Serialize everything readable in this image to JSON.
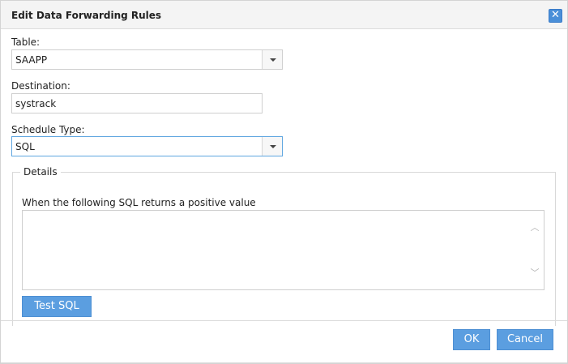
{
  "dialog": {
    "title": "Edit Data Forwarding Rules",
    "close_icon": "close-icon"
  },
  "form": {
    "table_label": "Table:",
    "table_value": "SAAPP",
    "destination_label": "Destination:",
    "destination_value": "systrack",
    "schedule_type_label": "Schedule Type:",
    "schedule_type_value": "SQL"
  },
  "details": {
    "legend": "Details",
    "sql_label": "When the following SQL returns a positive value",
    "sql_value": "",
    "test_sql_label": "Test SQL"
  },
  "footer": {
    "ok_label": "OK",
    "cancel_label": "Cancel"
  },
  "colors": {
    "accent": "#5b9ee0",
    "focus_border": "#5fa6e0"
  }
}
